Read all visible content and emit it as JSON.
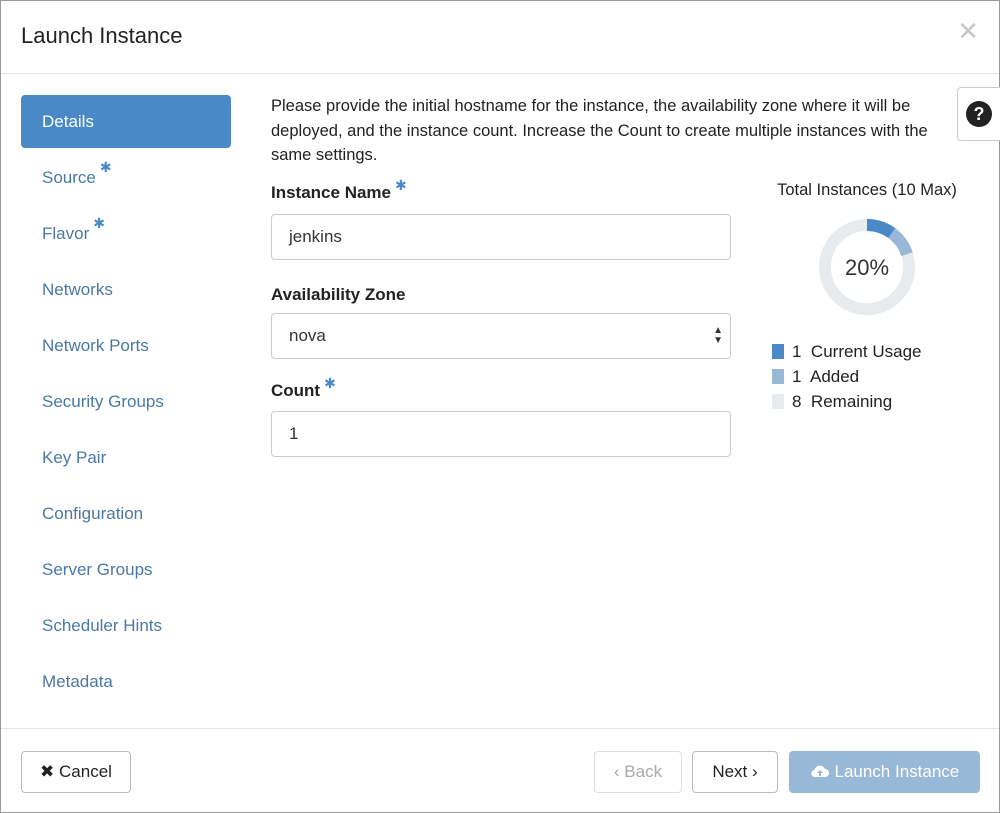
{
  "dialog": {
    "title": "Launch Instance",
    "close_icon": "times-icon"
  },
  "sidebar": {
    "items": [
      {
        "label": "Details",
        "required": false,
        "active": true
      },
      {
        "label": "Source",
        "required": true,
        "active": false
      },
      {
        "label": "Flavor",
        "required": true,
        "active": false
      },
      {
        "label": "Networks",
        "required": false,
        "active": false
      },
      {
        "label": "Network Ports",
        "required": false,
        "active": false
      },
      {
        "label": "Security Groups",
        "required": false,
        "active": false
      },
      {
        "label": "Key Pair",
        "required": false,
        "active": false
      },
      {
        "label": "Configuration",
        "required": false,
        "active": false
      },
      {
        "label": "Server Groups",
        "required": false,
        "active": false
      },
      {
        "label": "Scheduler Hints",
        "required": false,
        "active": false
      },
      {
        "label": "Metadata",
        "required": false,
        "active": false
      }
    ]
  },
  "help": {
    "icon": "question-circle-icon",
    "glyph": "?"
  },
  "description": "Please provide the initial hostname for the instance, the availability zone where it will be deployed, and the instance count. Increase the Count to create multiple instances with the same settings.",
  "form": {
    "instance_name": {
      "label": "Instance Name",
      "required_mark": "*",
      "value": "jenkins"
    },
    "availability_zone": {
      "label": "Availability Zone",
      "value": "nova"
    },
    "count": {
      "label": "Count",
      "required_mark": "*",
      "value": "1"
    }
  },
  "stats": {
    "title": "Total Instances (10 Max)",
    "percent_label": "20%",
    "legend": [
      {
        "count": "1",
        "label": "Current Usage",
        "color": "#4a89c8"
      },
      {
        "count": "1",
        "label": "Added",
        "color": "#98b8d8"
      },
      {
        "count": "8",
        "label": "Remaining",
        "color": "#e8ebee"
      }
    ]
  },
  "footer": {
    "cancel": {
      "icon": "times-icon",
      "label": "Cancel"
    },
    "back": {
      "icon": "chevron-left-icon",
      "label": "Back"
    },
    "next": {
      "icon": "chevron-right-icon",
      "label": "Next"
    },
    "launch": {
      "icon": "cloud-upload-icon",
      "label": "Launch Instance"
    }
  },
  "colors": {
    "accent": "#4a89c8",
    "accent_light": "#98b8d8",
    "link": "#4a78a4"
  }
}
